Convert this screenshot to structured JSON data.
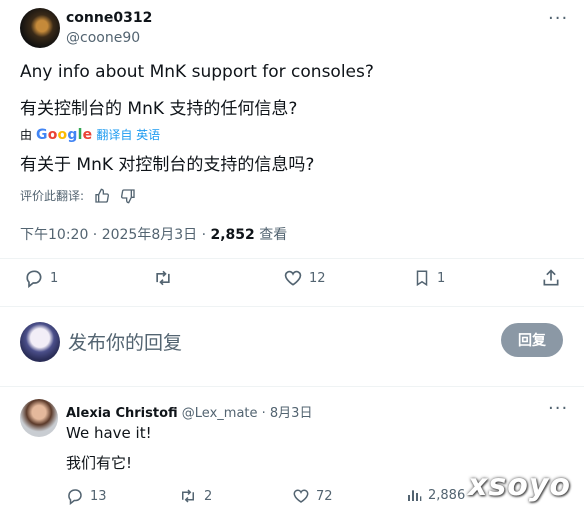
{
  "post": {
    "display_name": "conne0312",
    "handle": "@coone90",
    "text_en": "Any info about MnK support for consoles?",
    "text_zh": "有关控制台的 MnK 支持的任何信息?",
    "translated_by_prefix": "由",
    "translated_by_brand": "Google",
    "translated_from": "翻译自 英语",
    "translated_text": "有关于 MnK 对控制台的支持的信息吗?",
    "rate_translation": "评价此翻译:",
    "timestamp": "下午10:20 · 2025年8月3日 · ",
    "views_count": "2,852",
    "views_label": " 查看",
    "replies": "1",
    "reposts": "",
    "likes": "12",
    "bookmarks": "1"
  },
  "composer": {
    "placeholder": "发布你的回复",
    "reply_button": "回复"
  },
  "reply": {
    "display_name": "Alexia Christofi",
    "handle": "@Lex_mate",
    "date": " · 8月3日",
    "text_en": "We have it!",
    "text_zh": "我们有它!",
    "replies": "13",
    "reposts": "2",
    "likes": "72",
    "views": "2,886"
  },
  "watermark": "xsoyo",
  "colors": {
    "text": "#0f1419",
    "muted": "#536471",
    "link": "#1d9bf0",
    "reply_button_bg": "#8b98a5"
  }
}
